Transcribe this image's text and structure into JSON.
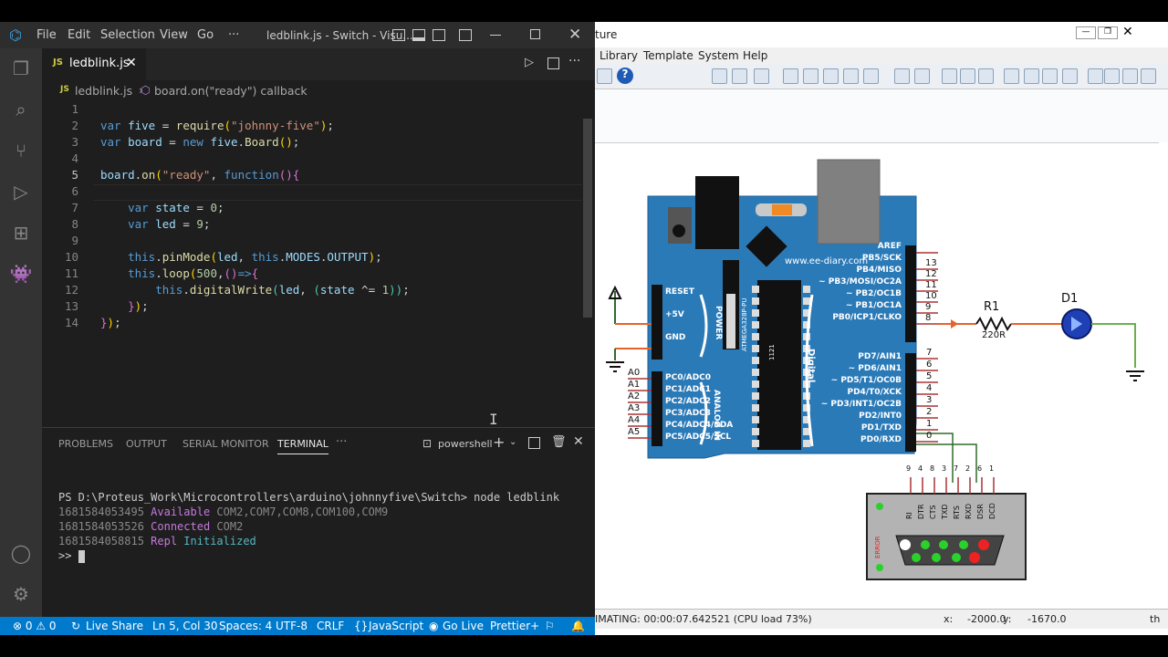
{
  "vscode": {
    "menu": [
      "File",
      "Edit",
      "Selection",
      "View",
      "Go",
      "···"
    ],
    "window_title": "ledblink.js - Switch - Visu...",
    "tab_label": "ledblink.js",
    "breadcrumb_file": "ledblink.js",
    "breadcrumb_symbol": "board.on(\"ready\") callback",
    "line_numbers": [
      "1",
      "2",
      "3",
      "4",
      "5",
      "6",
      "7",
      "8",
      "9",
      "10",
      "11",
      "12",
      "13",
      "14"
    ],
    "code_lines": [
      "",
      "var five = require(\"johnny-five\");",
      "var board = new five.Board();",
      "",
      "board.on(\"ready\", function(){",
      "",
      "    var state = 0;",
      "    var led = 9;",
      "",
      "    this.pinMode(led, this.MODES.OUTPUT);",
      "    this.loop(500,()=>{",
      "        this.digitalWrite(led, (state ^= 1));",
      "    });",
      "});"
    ],
    "panel_tabs": [
      "PROBLEMS",
      "OUTPUT",
      "SERIAL MONITOR",
      "TERMINAL",
      "···"
    ],
    "terminal_shell": "powershell",
    "terminal": {
      "cmd": "PS D:\\Proteus_Work\\Microcontrollers\\arduino\\johnnyfive\\Switch> node ledblink",
      "l1_ts": "1681584053495",
      "l1_a": "Available",
      "l1_b": "COM2,COM7,COM8,COM100,COM9",
      "l2_ts": "1681584053526",
      "l2_a": "Connected",
      "l2_b": "COM2",
      "l3_ts": "1681584058815",
      "l3_a": "Repl",
      "l3_b": "Initialized",
      "prompt": ">>"
    },
    "status": {
      "errors": "⊗ 0 ⚠ 0",
      "live_share": "Live Share",
      "position": "Ln 5, Col 30",
      "spaces": "Spaces: 4",
      "encoding": "UTF-8",
      "eol": "CRLF",
      "lang": "JavaScript",
      "golive": "Go Live",
      "prettier": "Prettier+"
    }
  },
  "proteus": {
    "title_fragment": "ture",
    "menu": [
      "Library",
      "Template",
      "System",
      "Help"
    ],
    "board_url": "www.ee-diary.com",
    "power_labels": [
      "RESET",
      "+5V",
      "GND"
    ],
    "power_title": "POWER",
    "analog_pins": [
      "PC0/ADC0",
      "PC1/ADC1",
      "PC2/ADC2",
      "PC3/ADC3",
      "PC4/ADC4/SDA",
      "PC5/ADC5/SCL"
    ],
    "analog_nets": [
      "A0",
      "A1",
      "A2",
      "A3",
      "A4",
      "A5"
    ],
    "analog_title": "ANALOG IN",
    "digital_title": "Digital",
    "chip_label": "ATMEGA328P-PU",
    "chip_num": "1121",
    "digital_pins_hi": [
      "AREF",
      "PB5/SCK",
      "PB4/MISO",
      "~ PB3/MOSI/OC2A",
      "~ PB2/OC1B",
      "~ PB1/OC1A",
      "PB0/ICP1/CLKO"
    ],
    "digital_nums_hi": [
      "13",
      "12",
      "11",
      "10",
      "9",
      "8"
    ],
    "digital_pins_lo": [
      "PD7/AIN1",
      "~ PD6/AIN1",
      "~ PD5/T1/OC0B",
      "PD4/T0/XCK",
      "~ PD3/INT1/OC2B",
      "PD2/INT0",
      "PD1/TXD",
      "PD0/RXD"
    ],
    "digital_nums_lo": [
      "7",
      "6",
      "5",
      "4",
      "3",
      "2",
      "1",
      "0"
    ],
    "resistor_name": "R1",
    "resistor_value": "220R",
    "diode_name": "D1",
    "serial_pins": [
      "RI",
      "DTR",
      "CTS",
      "TXD",
      "RTS",
      "RXD",
      "DSR",
      "DCD"
    ],
    "serial_nums": [
      "9",
      "4",
      "8",
      "3",
      "7",
      "2",
      "6",
      "1"
    ],
    "serial_error": "ERROR",
    "status_sim": "IMATING: 00:00:07.642521 (CPU load 73%)",
    "status_x_label": "x:",
    "status_x": "-2000.0",
    "status_y_label": "y:",
    "status_y": "-1670.0",
    "status_th": "th"
  }
}
